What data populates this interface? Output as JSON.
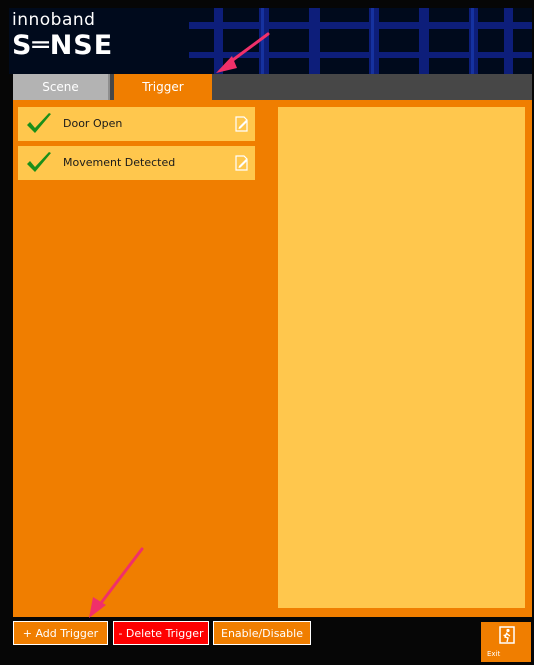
{
  "brand": {
    "line1": "innoband",
    "line2": "S═NSE"
  },
  "tabs": [
    {
      "label": "Scene",
      "active": false
    },
    {
      "label": "Trigger",
      "active": true
    }
  ],
  "triggers": [
    {
      "label": "Door Open",
      "enabled": true
    },
    {
      "label": "Movement Detected",
      "enabled": true
    }
  ],
  "buttons": {
    "add": "+ Add Trigger",
    "delete": "- Delete Trigger",
    "enable": "Enable/Disable",
    "exit": "Exit"
  },
  "colors": {
    "accent": "#f07e00",
    "panel": "#ffc74d",
    "delete": "#ff0000",
    "check": "#1a8f1a",
    "annotation": "#f0306a"
  }
}
